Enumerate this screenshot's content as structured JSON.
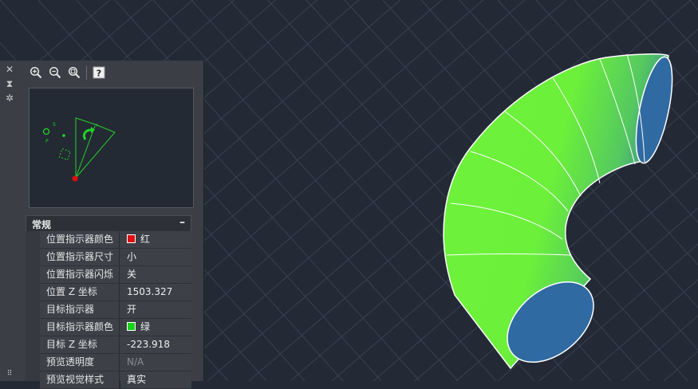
{
  "palette": {
    "side_buttons": [
      {
        "icon": "close-icon",
        "glyph": "✕"
      },
      {
        "icon": "pin-icon",
        "glyph": "⧗"
      },
      {
        "icon": "settings-icon",
        "glyph": "✲"
      }
    ],
    "toolbar": [
      {
        "icon": "zoom-in-icon"
      },
      {
        "icon": "zoom-out-icon"
      },
      {
        "icon": "zoom-extents-icon"
      },
      {
        "icon": "help-icon"
      }
    ],
    "section": {
      "title": "常规",
      "collapse_glyph": "–"
    },
    "properties": [
      {
        "name": "位置指示器颜色",
        "value": "红",
        "swatch": "#e01010"
      },
      {
        "name": "位置指示器尺寸",
        "value": "小"
      },
      {
        "name": "位置指示器闪烁",
        "value": "关"
      },
      {
        "name": "位置 Z 坐标",
        "value": "1503.327"
      },
      {
        "name": "目标指示器",
        "value": "开"
      },
      {
        "name": "目标指示器颜色",
        "value": "绿",
        "swatch": "#19d219"
      },
      {
        "name": "目标 Z 坐标",
        "value": "-223.918"
      },
      {
        "name": "预览透明度",
        "value": "N/A",
        "disabled": true
      },
      {
        "name": "预览视觉样式",
        "value": "真实"
      }
    ]
  },
  "colors": {
    "viewport_bg": "#232a36",
    "grid_line": "#3a4250",
    "elbow_green": "#6ef23a",
    "elbow_blue": "#2f6fa8",
    "indicator_red": "#e01010",
    "indicator_green": "#19d219"
  }
}
